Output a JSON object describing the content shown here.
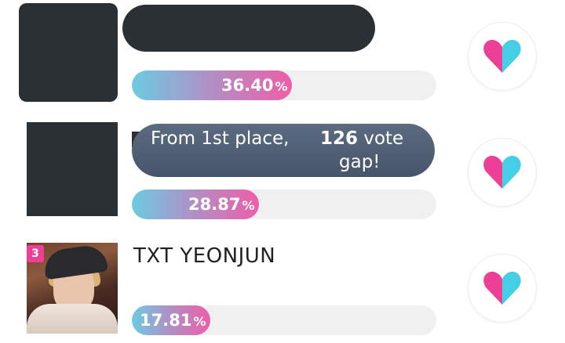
{
  "ranking": [
    {
      "rank": "",
      "name": "",
      "percent": "36.40",
      "percent_sign": "%",
      "share": 0.364,
      "heart_icon": "heart-icon"
    },
    {
      "rank": "",
      "name": "",
      "percent": "28.87",
      "percent_sign": "%",
      "share": 0.2887,
      "heart_icon": "heart-icon"
    },
    {
      "rank": "3",
      "name": "TXT YEONJUN",
      "percent": "17.81",
      "percent_sign": "%",
      "share": 0.1781,
      "heart_icon": "heart-icon"
    }
  ],
  "tooltip": {
    "prefix": "From 1st place,",
    "gap_number": "126",
    "gap_unit": "vote",
    "suffix": "gap!"
  },
  "colors": {
    "bar_start": "#6ccbe2",
    "bar_end": "#ee5ea8",
    "heart_pink": "#ee3f97",
    "heart_cyan": "#45cfe6",
    "badge": "#ee3f97",
    "tooltip_bg": "#4f5f74"
  }
}
